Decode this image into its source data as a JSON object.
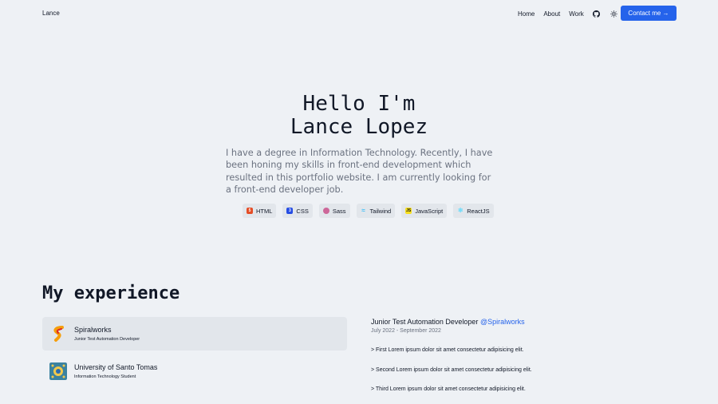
{
  "header": {
    "brand": "Lance",
    "nav": [
      "Home",
      "About",
      "Work"
    ],
    "github_icon": "github-icon",
    "theme_icon": "sun-icon",
    "contact_label": "Contact me →",
    "accent_color": "#2563eb"
  },
  "hero": {
    "title_line1": "Hello I'm",
    "title_line2": "Lance Lopez",
    "description": "I have a degree in Information Technology. Recently, I have been honing my skills in front-end development which resulted in this portfolio website. I am currently looking for a front-end developer job.",
    "skills": [
      {
        "label": "HTML",
        "icon": "html5-icon",
        "color": "#e44d26"
      },
      {
        "label": "CSS",
        "icon": "css3-icon",
        "color": "#264de4"
      },
      {
        "label": "Sass",
        "icon": "sass-icon",
        "color": "#cd6799"
      },
      {
        "label": "Tailwind",
        "icon": "tailwind-icon",
        "color": "#38bdf8"
      },
      {
        "label": "JavaScript",
        "icon": "javascript-icon",
        "color": "#f7df1e"
      },
      {
        "label": "ReactJS",
        "icon": "react-icon",
        "color": "#61dafb"
      }
    ]
  },
  "experience": {
    "heading": "My experience",
    "items": [
      {
        "name": "Spiralworks",
        "role": "Junior Test Automation Developer",
        "logo": "spiralworks-logo-icon"
      },
      {
        "name": "University of Santo Tomas",
        "role": "Information Technology Student",
        "logo": "ust-logo-icon"
      }
    ],
    "detail": {
      "title": "Junior Test Automation Developer",
      "company": "@Spiralworks",
      "dates": "July 2022 - September 2022",
      "points": [
        "> First Lorem ipsum dolor sit amet consectetur adipisicing elit.",
        "> Second Lorem ipsum dolor sit amet consectetur adipisicing elit.",
        "> Third Lorem ipsum dolor sit amet consectetur adipisicing elit."
      ]
    }
  }
}
